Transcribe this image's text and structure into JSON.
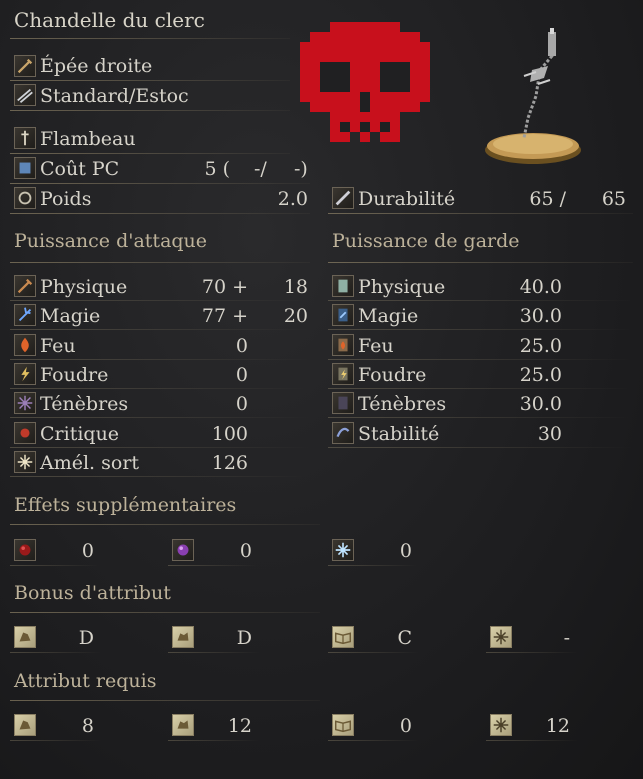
{
  "title": "Chandelle du clerc",
  "weapon_type": "Épée droite",
  "attack_type": "Standard/Estoc",
  "skill": "Flambeau",
  "fp_cost": {
    "label": "Coût PC",
    "value": "5 (",
    "mid": "-/",
    "end": "-)"
  },
  "weight": {
    "label": "Poids",
    "value": "2.0"
  },
  "durability": {
    "label": "Durabilité",
    "current": "65 /",
    "max": "65"
  },
  "attack": {
    "header": "Puissance d'attaque",
    "rows": [
      {
        "label": "Physique",
        "value": "70 +",
        "bonus": "18",
        "icon": "physical-attack-icon"
      },
      {
        "label": "Magie",
        "value": "77 +",
        "bonus": "20",
        "icon": "magic-attack-icon"
      },
      {
        "label": "Feu",
        "value": "0",
        "bonus": "",
        "icon": "fire-attack-icon"
      },
      {
        "label": "Foudre",
        "value": "0",
        "bonus": "",
        "icon": "lightning-attack-icon"
      },
      {
        "label": "Ténèbres",
        "value": "0",
        "bonus": "",
        "icon": "dark-attack-icon"
      },
      {
        "label": "Critique",
        "value": "100",
        "bonus": "",
        "icon": "critical-icon"
      },
      {
        "label": "Amél. sort",
        "value": "126",
        "bonus": "",
        "icon": "spell-buff-icon"
      }
    ]
  },
  "guard": {
    "header": "Puissance de garde",
    "rows": [
      {
        "label": "Physique",
        "value": "40.0",
        "icon": "physical-guard-icon"
      },
      {
        "label": "Magie",
        "value": "30.0",
        "icon": "magic-guard-icon"
      },
      {
        "label": "Feu",
        "value": "25.0",
        "icon": "fire-guard-icon"
      },
      {
        "label": "Foudre",
        "value": "25.0",
        "icon": "lightning-guard-icon"
      },
      {
        "label": "Ténèbres",
        "value": "30.0",
        "icon": "dark-guard-icon"
      },
      {
        "label": "Stabilité",
        "value": "30",
        "icon": "stability-icon"
      }
    ]
  },
  "effects": {
    "header": "Effets supplémentaires",
    "items": [
      {
        "icon": "bleed-icon",
        "value": "0"
      },
      {
        "icon": "poison-icon",
        "value": "0"
      },
      {
        "icon": "frost-icon",
        "value": "0"
      }
    ]
  },
  "scaling": {
    "header": "Bonus d'attribut",
    "items": [
      {
        "icon": "strength-icon",
        "value": "D"
      },
      {
        "icon": "dexterity-icon",
        "value": "D"
      },
      {
        "icon": "intelligence-icon",
        "value": "C"
      },
      {
        "icon": "faith-icon",
        "value": "-"
      }
    ]
  },
  "requirements": {
    "header": "Attribut requis",
    "items": [
      {
        "icon": "strength-icon",
        "value": "8"
      },
      {
        "icon": "dexterity-icon",
        "value": "12"
      },
      {
        "icon": "intelligence-icon",
        "value": "0"
      },
      {
        "icon": "faith-icon",
        "value": "12"
      }
    ]
  },
  "colors": {
    "skull": "#c8101c",
    "text": "#d6d3ca",
    "header": "#bdb29a"
  }
}
